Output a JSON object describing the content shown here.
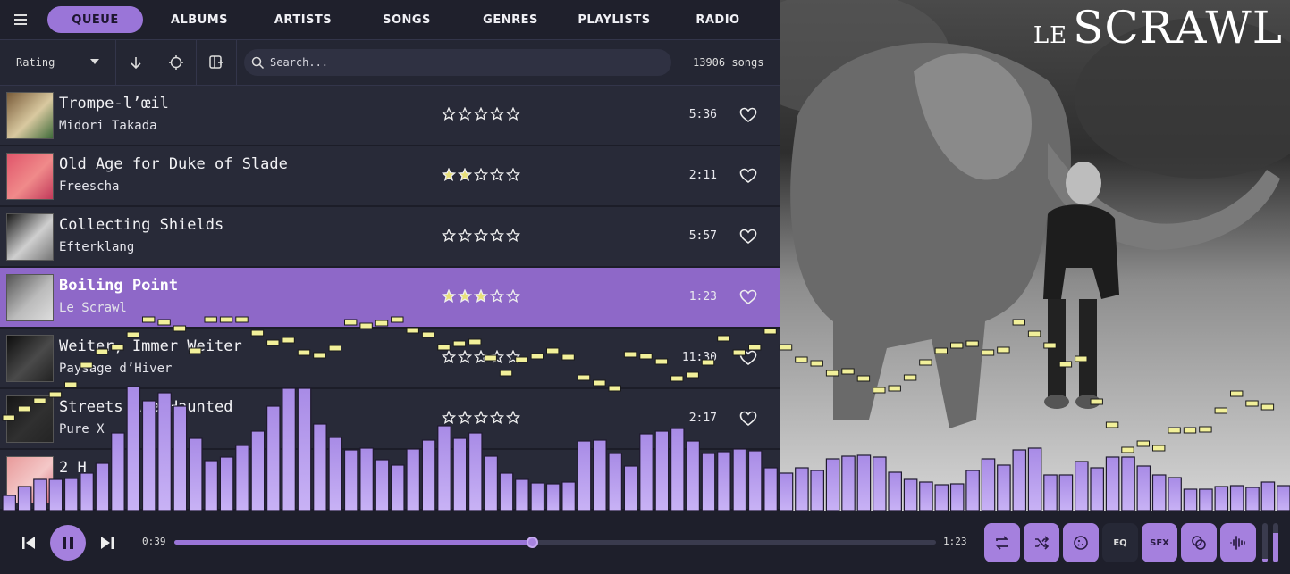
{
  "nav": {
    "tabs": [
      "QUEUE",
      "ALBUMS",
      "ARTISTS",
      "SONGS",
      "GENRES",
      "PLAYLISTS",
      "RADIO"
    ],
    "active": "QUEUE"
  },
  "toolbar": {
    "sort_value": "Rating",
    "search_placeholder": "Search...",
    "song_count": "13906 songs"
  },
  "songs": [
    {
      "title": "Trompe-l’œil",
      "artist": "Midori Takada",
      "rating": 0,
      "duration": "5:36",
      "thumb_colors": [
        "#7a5c3a",
        "#d9c9a0",
        "#3f6b3a"
      ]
    },
    {
      "title": "Old Age for Duke of Slade",
      "artist": "Freescha",
      "rating": 2,
      "duration": "2:11",
      "thumb_colors": [
        "#e0556a",
        "#f08a8a",
        "#c23a5a"
      ]
    },
    {
      "title": "Collecting Shields",
      "artist": "Efterklang",
      "rating": 0,
      "duration": "5:57",
      "thumb_colors": [
        "#1a1a1a",
        "#cfcfcf",
        "#777777"
      ]
    },
    {
      "title": "Boiling Point",
      "artist": "Le Scrawl",
      "rating": 3,
      "duration": "1:23",
      "thumb_colors": [
        "#555555",
        "#bbbbbb",
        "#dddddd"
      ],
      "current": true
    },
    {
      "title": "Weiter, Immer Weiter",
      "artist": "Paysage d’Hiver",
      "rating": 0,
      "duration": "11:30",
      "thumb_colors": [
        "#0e0e0e",
        "#4a4a4a",
        "#222222"
      ]
    },
    {
      "title": "Streets Are Haunted",
      "artist": "Pure X",
      "rating": 0,
      "duration": "2:17",
      "thumb_colors": [
        "#161616",
        "#303030",
        "#242424"
      ]
    },
    {
      "title": "2 H",
      "artist": "",
      "rating": 0,
      "duration": "",
      "thumb_colors": [
        "#e89a9a",
        "#f4c8c8",
        "#d66a7a"
      ]
    }
  ],
  "album_art": {
    "title_small": "LE",
    "title_big": "SCRAWL"
  },
  "visualizer": {
    "bars": [
      17,
      27,
      35,
      35,
      36,
      42,
      53,
      87,
      139,
      123,
      132,
      117,
      81,
      56,
      60,
      73,
      89,
      117,
      137,
      137,
      97,
      82,
      68,
      70,
      57,
      51,
      69,
      79,
      95,
      81,
      87,
      61,
      42,
      35,
      31,
      30,
      32,
      78,
      79,
      64,
      50,
      86,
      89,
      92,
      78,
      64,
      66,
      69,
      67,
      48,
      42,
      48,
      45,
      58,
      61,
      62,
      60,
      43,
      35,
      32,
      29,
      30,
      45,
      58,
      51,
      68,
      70,
      40,
      40,
      55,
      48,
      60,
      60,
      50,
      40,
      37,
      24,
      24,
      27,
      28,
      26,
      32,
      28
    ],
    "caps": [
      103,
      113,
      122,
      129,
      140,
      162,
      177,
      182,
      196,
      213,
      210,
      203,
      178,
      213,
      213,
      213,
      198,
      187,
      190,
      176,
      173,
      181,
      210,
      206,
      209,
      213,
      201,
      196,
      182,
      186,
      188,
      170,
      153,
      168,
      172,
      178,
      171,
      148,
      142,
      136,
      174,
      172,
      166,
      147,
      151,
      165,
      192,
      176,
      182,
      200,
      182,
      168,
      164,
      153,
      155,
      147,
      134,
      136,
      148,
      165,
      178,
      184,
      186,
      176,
      179,
      210,
      197,
      184,
      163,
      169,
      121,
      95,
      67,
      74,
      69,
      89,
      89,
      90,
      111,
      130,
      119,
      115
    ],
    "colors": {
      "bar": "#a88be6",
      "bar_top": "#c8b2f5",
      "cap": "#f2f09a"
    }
  },
  "player": {
    "elapsed": "0:39",
    "total": "1:23",
    "progress": 0.47,
    "eq_label": "EQ",
    "sfx_label": "SFX",
    "volume_levels": [
      0.1,
      0.75
    ]
  },
  "colors": {
    "accent": "#9a75d8",
    "star_filled": "#e8e07a"
  }
}
